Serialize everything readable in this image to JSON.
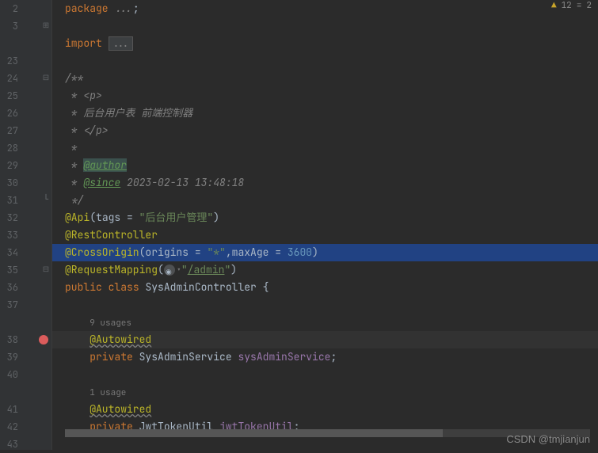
{
  "topright": {
    "warn_count": "12",
    "hint_count": "2"
  },
  "gutter": [
    {
      "n": "2",
      "fold": ""
    },
    {
      "n": "3",
      "fold": "+"
    },
    {
      "n": ""
    },
    {
      "n": "23"
    },
    {
      "n": "24",
      "fold": "-"
    },
    {
      "n": "25"
    },
    {
      "n": "26"
    },
    {
      "n": "27"
    },
    {
      "n": "28"
    },
    {
      "n": "29"
    },
    {
      "n": "30"
    },
    {
      "n": "31",
      "fold": "⌐"
    },
    {
      "n": "32"
    },
    {
      "n": "33",
      "icon": "spring"
    },
    {
      "n": "34"
    },
    {
      "n": "35",
      "fold": "-"
    },
    {
      "n": "36",
      "icon": "spring2"
    },
    {
      "n": "37"
    },
    {
      "n": ""
    },
    {
      "n": "38",
      "bp": true
    },
    {
      "n": "39",
      "icon": "spring2"
    },
    {
      "n": "40"
    },
    {
      "n": ""
    },
    {
      "n": "41"
    },
    {
      "n": "42",
      "icon": "spring2"
    },
    {
      "n": "43"
    }
  ],
  "code": {
    "l1_pkg": "package",
    "l1_pkgdot": "...",
    "l1_semicolon": ";",
    "l2_import": "import",
    "l2_dots": "...",
    "l4_c": "/**",
    "l5_s": " * ",
    "l5_open": "<p>",
    "l6_s": " * ",
    "l6_txt": "后台用户表 前端控制器",
    "l7_s": " * ",
    "l7_close": "</p>",
    "l8_s": " *",
    "l9_s": " * ",
    "l9_tag": "@author",
    "l10_s": " * ",
    "l10_tag": "@since",
    "l10_d": " 2023-02-13 13:48:18",
    "l11_s": " */",
    "l12_api": "@Api",
    "l12_open": "(",
    "l12_tags": "tags",
    "l12_eq": " = ",
    "l12_val": "\"后台用户管理\"",
    "l12_close": ")",
    "l13": "@RestController",
    "l14_co": "@CrossOrigin",
    "l14_open": "(",
    "l14_o": "origins",
    "l14_eq": " = ",
    "l14_ov": "\"*\"",
    "l14_comma": ",",
    "l14_m": "maxAge",
    "l14_eq2": " = ",
    "l14_mv": "3600",
    "l14_close": ")",
    "l15_rm": "@RequestMapping",
    "l15_open": "(",
    "l15_val": "/admin",
    "l15_q": "\"",
    "l15_close": ")",
    "l16_pub": "public",
    "l16_class": "class",
    "l16_name": "SysAdminController",
    "l16_brace": " {",
    "usages9": "9 usages",
    "l18": "@Autowired",
    "l19_priv": "private",
    "l19_type": "SysAdminService",
    "l19_field": "sysAdminService",
    "l19_sc": ";",
    "usages1": "1 usage",
    "l21": "@Autowired",
    "l22_priv": "private",
    "l22_type": "JwtTokenUtil",
    "l22_field": "jwtTokenUtil",
    "l22_sc": ";"
  },
  "watermark": "CSDN @tmjianjun"
}
